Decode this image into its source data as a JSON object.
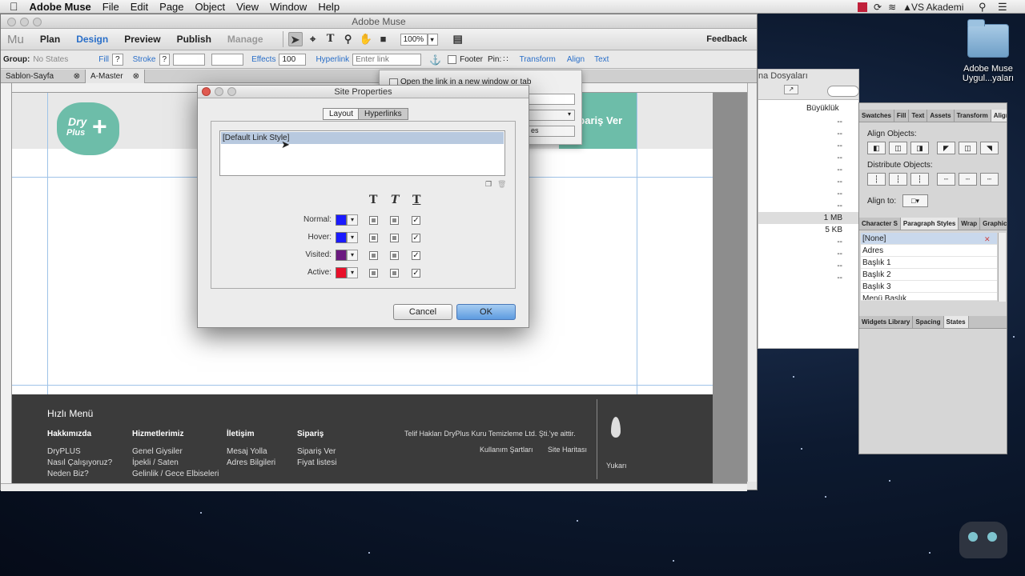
{
  "menubar": {
    "apple": "",
    "items": [
      "Adobe Muse",
      "File",
      "Edit",
      "Page",
      "Object",
      "View",
      "Window",
      "Help"
    ],
    "user": "VS Akademi"
  },
  "desktop": {
    "folder_label": "Adobe Muse Uygul...yaları"
  },
  "window": {
    "title": "Adobe Muse",
    "logo": "Mu",
    "modes": [
      "Plan",
      "Design",
      "Preview",
      "Publish",
      "Manage"
    ],
    "zoom": "100%",
    "feedback": "Feedback"
  },
  "controlbar": {
    "group_label": "Group:",
    "group_value": "No States",
    "fill": "Fill",
    "stroke": "Stroke",
    "stroke_value": "?",
    "fill_value": "?",
    "effects": "Effects",
    "opacity": "100",
    "hyperlink": "Hyperlink",
    "hyperlink_placeholder": "Enter link",
    "footer": "Footer",
    "pin": "Pin:",
    "transform": "Transform",
    "align": "Align",
    "text": "Text"
  },
  "tabs": [
    "Sablon-Sayfa",
    "A-Master"
  ],
  "hyperlink_popup": {
    "option": "Open the link in a new window or tab",
    "partial": "es"
  },
  "site": {
    "logo_line1": "Dry",
    "logo_line2": "Plus",
    "order_button": "Sipariş Ver",
    "footer_menu_title": "Hızlı Menü",
    "footer_cols": [
      {
        "title": "Hakkımızda",
        "items": [
          "DryPLUS",
          "Nasıl Çalışıyoruz?",
          "Neden Biz?"
        ]
      },
      {
        "title": "Hizmetlerimiz",
        "items": [
          "Genel Giysiler",
          "İpekli / Saten",
          "Gelinlik / Gece Elbiseleri"
        ]
      },
      {
        "title": "İletişim",
        "items": [
          "Mesaj Yolla",
          "Adres Bilgileri"
        ]
      },
      {
        "title": "Sipariş",
        "items": [
          "Sipariş Ver",
          "Fiyat listesi"
        ]
      }
    ],
    "copyright": "Telif Hakları DryPlus Kuru Temizleme Ltd. Şti.'ye aittir.",
    "terms": "Kullanım Şartları",
    "sitemap": "Site Haritası",
    "up": "Yukarı"
  },
  "assets_window": {
    "partial_title": "na Dosyaları",
    "size_header": "Büyüklük",
    "sizes": [
      "--",
      "--",
      "--",
      "--",
      "--",
      "--",
      "--",
      "--",
      "1 MB",
      "5 KB",
      "--",
      "--",
      "--",
      "--"
    ]
  },
  "dialog": {
    "title": "Site Properties",
    "tabs": [
      "Layout",
      "Hyperlinks"
    ],
    "active_tab": "Hyperlinks",
    "style_list": [
      "[Default Link Style]"
    ],
    "style_headers": [
      "T",
      "T",
      "T"
    ],
    "rows": [
      {
        "label": "Normal:",
        "color": "#1a1aff"
      },
      {
        "label": "Hover:",
        "color": "#1a1aff"
      },
      {
        "label": "Visited:",
        "color": "#6b1a80"
      },
      {
        "label": "Active:",
        "color": "#e8102a"
      }
    ],
    "cancel": "Cancel",
    "ok": "OK"
  },
  "panel": {
    "tabs_top": [
      "Swatches",
      "Fill",
      "Text",
      "Assets",
      "Transform",
      "Align"
    ],
    "align_objects": "Align Objects:",
    "distribute_objects": "Distribute Objects:",
    "align_to": "Align to:",
    "tabs_mid": [
      "Character S",
      "Paragraph Styles",
      "Wrap",
      "Graphic Sty"
    ],
    "paragraph_styles": [
      "[None]",
      "Adres",
      "Başlık 1",
      "Başlık 2",
      "Başlık 3",
      "Menü Başlık"
    ],
    "tabs_bottom": [
      "Widgets Library",
      "Spacing",
      "States"
    ]
  }
}
